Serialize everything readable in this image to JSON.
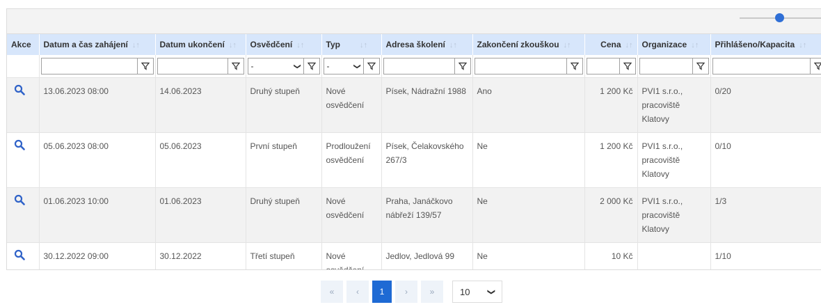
{
  "columns": [
    {
      "label": "Akce",
      "sortable": false
    },
    {
      "label": "Datum a čas zahájení",
      "sortable": true
    },
    {
      "label": "Datum ukončení",
      "sortable": true
    },
    {
      "label": "Osvědčení",
      "sortable": true
    },
    {
      "label": "Typ",
      "sortable": true
    },
    {
      "label": "Adresa školení",
      "sortable": true
    },
    {
      "label": "Zakončení zkouškou",
      "sortable": true
    },
    {
      "label": "Cena",
      "sortable": true
    },
    {
      "label": "Organizace",
      "sortable": true
    },
    {
      "label": "Přihlášeno/Kapacita",
      "sortable": true
    }
  ],
  "filters": {
    "osvedceni_value": "-",
    "typ_value": "-"
  },
  "rows": [
    {
      "datum_zahajeni": "13.06.2023 08:00",
      "datum_ukonceni": "14.06.2023",
      "osvedceni": "Druhý stupeň",
      "typ": "Nové osvědčení",
      "adresa": "Písek, Nádražní 1988",
      "zakonceni": "Ano",
      "cena": "1 200 Kč",
      "organizace": "PVI1 s.r.o., pracoviště Klatovy",
      "prihlaseno": "0/20"
    },
    {
      "datum_zahajeni": "05.06.2023 08:00",
      "datum_ukonceni": "05.06.2023",
      "osvedceni": "První stupeň",
      "typ": "Prodloužení osvědčení",
      "adresa": "Písek, Čelakovského 267/3",
      "zakonceni": "Ne",
      "cena": "1 200 Kč",
      "organizace": "PVI1 s.r.o., pracoviště Klatovy",
      "prihlaseno": "0/10"
    },
    {
      "datum_zahajeni": "01.06.2023 10:00",
      "datum_ukonceni": "01.06.2023",
      "osvedceni": "Druhý stupeň",
      "typ": "Nové osvědčení",
      "adresa": "Praha, Janáčkovo nábřeží 139/57",
      "zakonceni": "Ne",
      "cena": "2 000 Kč",
      "organizace": "PVI1 s.r.o., pracoviště Klatovy",
      "prihlaseno": "1/3"
    },
    {
      "datum_zahajeni": "30.12.2022 09:00",
      "datum_ukonceni": "30.12.2022",
      "osvedceni": "Třetí stupeň",
      "typ": "Nové osvědčení",
      "adresa": "Jedlov, Jedlová 99",
      "zakonceni": "Ne",
      "cena": "10 Kč",
      "organizace": "",
      "prihlaseno": "1/10"
    }
  ],
  "pagination": {
    "first": "«",
    "prev": "‹",
    "current": "1",
    "next": "›",
    "last": "»",
    "page_size": "10"
  },
  "icons": {
    "detail": "search-icon",
    "filter": "filter-icon",
    "sort": "sort-icon"
  },
  "colors": {
    "header_bg": "#d7e6fb",
    "accent": "#1e6ad4",
    "search_icon": "#2f62c8"
  }
}
